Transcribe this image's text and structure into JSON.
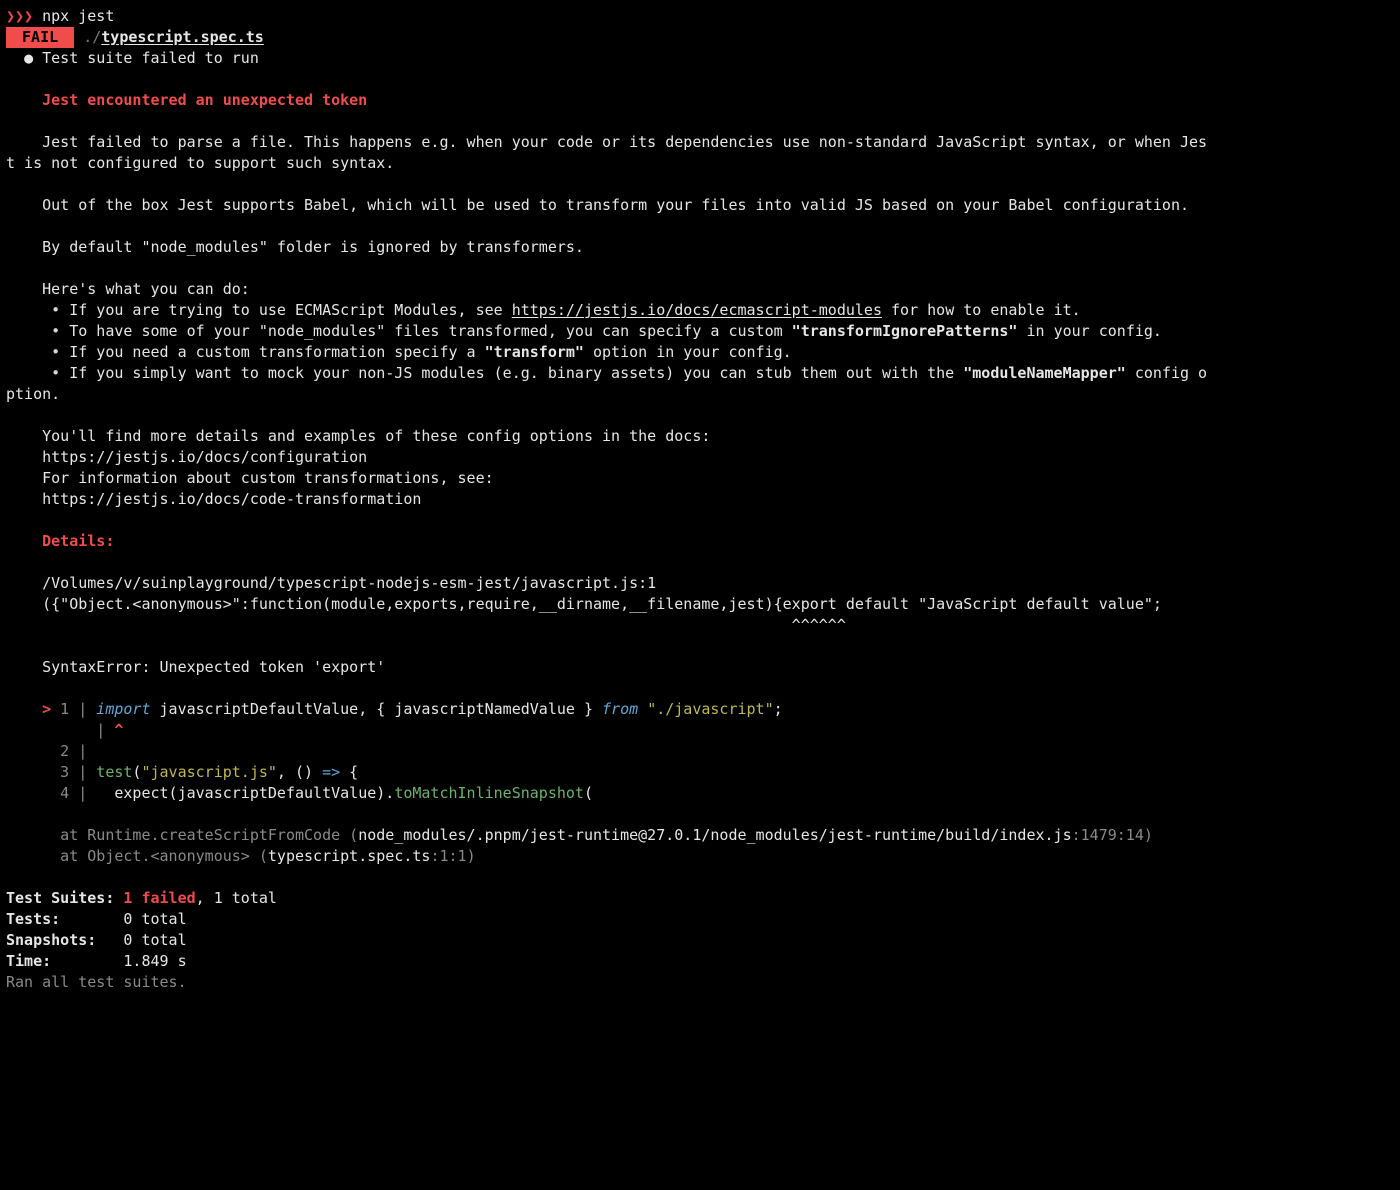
{
  "prompt": {
    "chevrons": "❯❯❯",
    "cmd": " npx jest"
  },
  "fail_badge": " FAIL ",
  "test_path_dim": " ./",
  "test_file": "typescript.spec.ts",
  "suite_failed": "Test suite failed to run",
  "heading_error": "Jest encountered an unexpected token",
  "p1a": "Jest failed to parse a file. This happens e.g. when your code or its dependencies use non-standard JavaScript syntax, or when Jes",
  "p1b": "t is not configured to support such syntax.",
  "p2": "Out of the box Jest supports Babel, which will be used to transform your files into valid JS based on your Babel configuration.",
  "p3": "By default \"node_modules\" folder is ignored by transformers.",
  "p4": "Here's what you can do:",
  "b1a": "If you are trying to use ECMAScript Modules, see ",
  "b1_link": "https://jestjs.io/docs/ecmascript-modules",
  "b1b": " for how to enable it.",
  "b2a": "To have some of your \"node_modules\" files transformed, you can specify a custom ",
  "b2_bold": "\"transformIgnorePatterns\"",
  "b2b": " in your config.",
  "b3a": "If you need a custom transformation specify a ",
  "b3_bold": "\"transform\"",
  "b3b": " option in your config.",
  "b4a": "If you simply want to mock your non-JS modules (e.g. binary assets) you can stub them out with the ",
  "b4_bold": "\"moduleNameMapper\"",
  "b4b": " config o",
  "b4c": "ption.",
  "p5": "You'll find more details and examples of these config options in the docs:",
  "link1": "https://jestjs.io/docs/configuration",
  "p6": "For information about custom transformations, see:",
  "link2": "https://jestjs.io/docs/code-transformation",
  "details": "Details:",
  "file_loc": "/Volumes/v/suinplayground/typescript-nodejs-esm-jest/javascript.js:1",
  "wrapped_code": "({\"Object.<anonymous>\":function(module,exports,require,__dirname,__filename,jest){export default \"JavaScript default value\";",
  "carets_pad": "                                                                                   ",
  "carets": "^^^^^^",
  "syntax_err": "SyntaxError: Unexpected token 'export'",
  "code": {
    "gutter_arrow": ">",
    "ln1": "1",
    "ln2": "2",
    "ln3": "3",
    "ln4": "4",
    "pipe": "|",
    "l1_import": "import",
    "l1_mid": " javascriptDefaultValue, { javascriptNamedValue } ",
    "l1_from": "from",
    "l1_sp": " ",
    "l1_str": "\"./javascript\"",
    "l1_semi": ";",
    "caret_line_pad": "      | ",
    "caret_line": "^",
    "l3_test": "test",
    "l3_paren": "(",
    "l3_str": "\"javascript.js\"",
    "l3_rest": ", () ",
    "l3_arrow": "=>",
    "l3_brace": " {",
    "l4_indent": "  expect(javascriptDefaultValue).",
    "l4_method": "toMatchInlineSnapshot",
    "l4_paren": "("
  },
  "stack1_at": "at Runtime.createScriptFromCode (",
  "stack1_path": "node_modules/.pnpm/jest-runtime@27.0.1/node_modules/jest-runtime/build/index.js",
  "stack1_loc": ":1479:14",
  "stack1_close": ")",
  "stack2_at": "at Object.<anonymous> (",
  "stack2_path": "typescript.spec.ts",
  "stack2_loc": ":1:1",
  "stack2_close": ")",
  "summary": {
    "suites_label": "Test Suites: ",
    "suites_fail": "1 failed",
    "suites_rest": ", 1 total",
    "tests_label": "Tests:       ",
    "tests_val": "0 total",
    "snaps_label": "Snapshots:   ",
    "snaps_val": "0 total",
    "time_label": "Time:        ",
    "time_val": "1.849 s",
    "ran": "Ran all test suites."
  }
}
